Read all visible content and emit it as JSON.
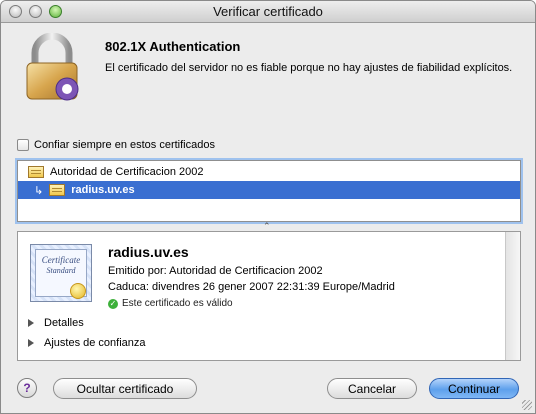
{
  "window": {
    "title": "Verificar certificado"
  },
  "header": {
    "heading": "802.1X Authentication",
    "message": "El certificado del servidor no es fiable porque no hay ajustes de fiabilidad explícitos."
  },
  "trust_checkbox": {
    "label": "Confiar siempre en estos certificados",
    "checked": false
  },
  "tree": {
    "items": [
      {
        "label": "Autoridad de Certificacion 2002",
        "selected": false
      },
      {
        "arrow": "↳",
        "label": "radius.uv.es",
        "selected": true
      }
    ]
  },
  "details": {
    "cert_image_line1": "Certificate",
    "cert_image_line2": "Standard",
    "name": "radius.uv.es",
    "issued_by": "Emitido por: Autoridad de Certificacion 2002",
    "expires": "Caduca: divendres 26 gener 2007 22:31:39 Europe/Madrid",
    "validity": "Este certificado es válido",
    "disclosures": [
      "Detalles",
      "Ajustes de confianza"
    ]
  },
  "buttons": {
    "help": "?",
    "hide_certificate": "Ocultar certificado",
    "cancel": "Cancelar",
    "continue": "Continuar"
  },
  "colors": {
    "selection": "#3a6fd1",
    "default_button": "#5ea0ec",
    "valid": "#3db03a"
  }
}
